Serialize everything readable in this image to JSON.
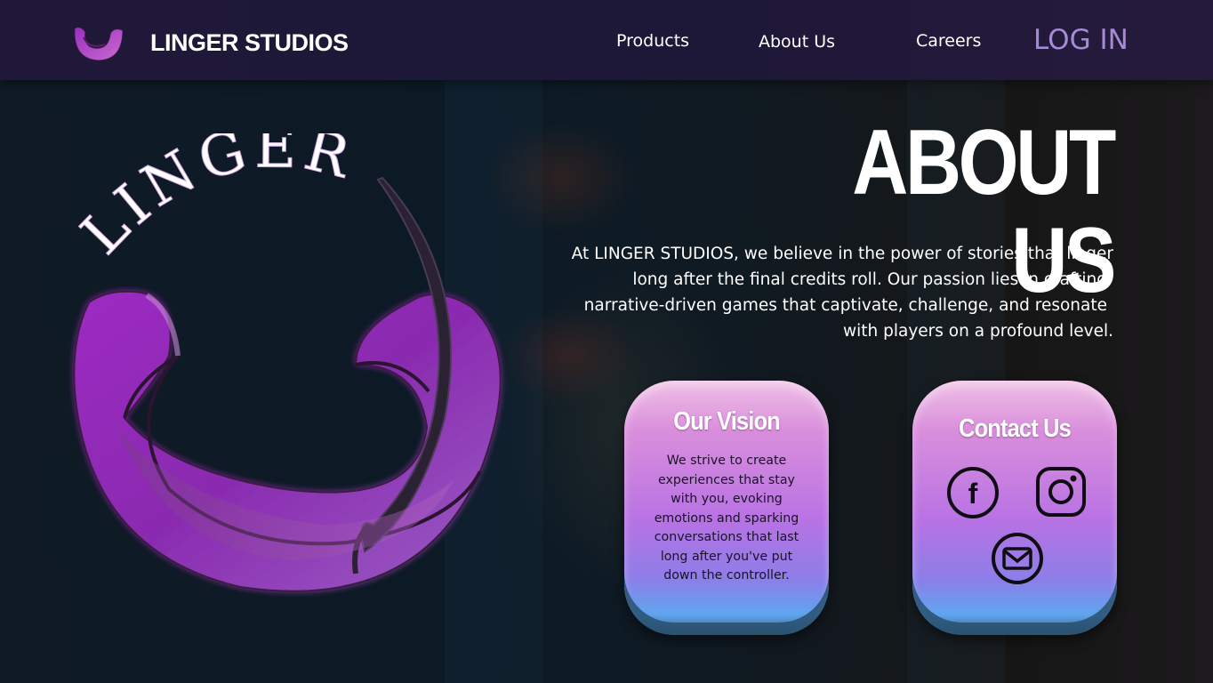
{
  "header": {
    "brand_name": "LINGER STUDIOS",
    "brand_logo_icon": "linger-u-logo-icon",
    "nav": {
      "products": "Products",
      "about": "About Us",
      "careers": "Careers"
    },
    "login_label": "LOG IN"
  },
  "hero": {
    "logo_text": "LINGER",
    "logo_icon": "linger-u-logo-icon"
  },
  "about": {
    "title": "ABOUT US",
    "lines": [
      "At LINGER STUDIOS, we believe in the power of stories that linger",
      "long after the final credits roll. Our passion lies in crafting",
      "narrative-driven games that captivate, challenge, and resonate",
      "with players on a profound level."
    ]
  },
  "vision_card": {
    "title": "Our Vision",
    "lines": [
      "We strive to create",
      "experiences that stay",
      "with you, evoking",
      "emotions and sparking",
      "conversations that last",
      "long after you've put",
      "down the controller."
    ]
  },
  "contact_card": {
    "title": "Contact Us",
    "icons": [
      "facebook-icon",
      "instagram-icon",
      "email-icon"
    ]
  },
  "colors": {
    "header_bg": "#1f1838",
    "login": "#a58ad6",
    "brand_purple": "#8a2bb0",
    "card_top": "#f0bfe6",
    "card_bottom": "#5fa5ef"
  }
}
